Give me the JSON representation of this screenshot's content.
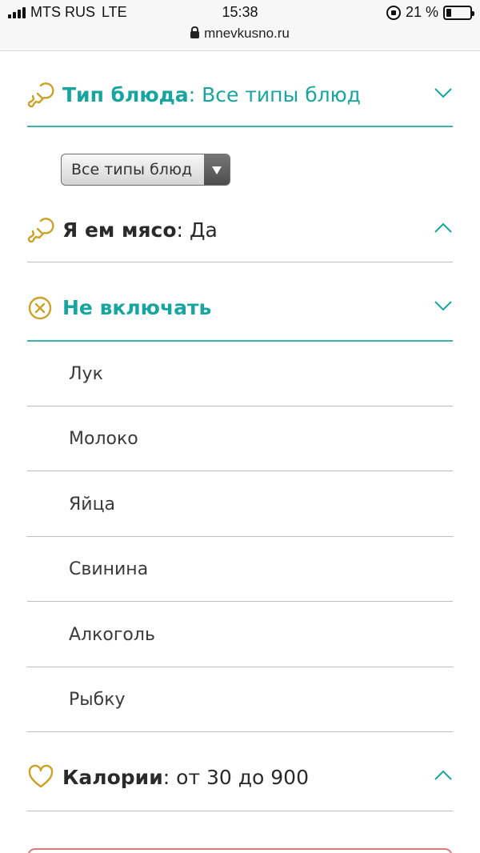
{
  "status_bar": {
    "carrier": "MTS RUS",
    "network": "LTE",
    "time": "15:38",
    "battery": "21 %",
    "url": "mnevkusno.ru"
  },
  "dish_type": {
    "title": "Тип блюда",
    "separator": ":",
    "value": "Все типы блюд",
    "select_value": "Все типы блюд"
  },
  "meat": {
    "title": "Я ем мясо",
    "separator": ":",
    "value": "Да"
  },
  "exclude": {
    "title": "Не включать",
    "items": [
      "Лук",
      "Молоко",
      "Яйца",
      "Свинина",
      "Алкоголь",
      "Рыбку"
    ]
  },
  "calories": {
    "title": "Калории",
    "separator": ":",
    "value": "от 30 до 900"
  },
  "colors": {
    "accent": "#17a5a0",
    "icon_gold": "#c9a227",
    "text_dark": "#2a2a2a"
  },
  "icons": {
    "dish_type": "drumstick-icon",
    "meat": "drumstick-icon",
    "exclude": "x-circle-icon",
    "calories": "heart-icon"
  }
}
